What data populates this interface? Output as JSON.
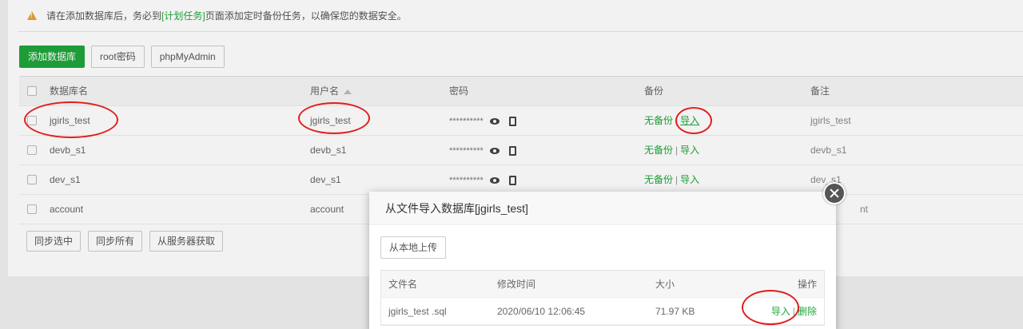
{
  "alert": {
    "text_before": "请在添加数据库后，务必到",
    "link": "[计划任务]",
    "text_after": "页面添加定时备份任务，以确保您的数据安全。"
  },
  "toolbar": {
    "add_label": "添加数据库",
    "root_label": "root密码",
    "pma_label": "phpMyAdmin"
  },
  "table": {
    "headers": {
      "name": "数据库名",
      "user": "用户名",
      "password": "密码",
      "backup": "备份",
      "remark": "备注"
    },
    "rows": [
      {
        "name": "jgirls_test",
        "user": "jgirls_test",
        "password": "**********",
        "backup": "无备份",
        "import": "导入",
        "remark": "jgirls_test"
      },
      {
        "name": "devb_s1",
        "user": "devb_s1",
        "password": "**********",
        "backup": "无备份",
        "import": "导入",
        "remark": "devb_s1"
      },
      {
        "name": "dev_s1",
        "user": "dev_s1",
        "password": "**********",
        "backup": "无备份",
        "import": "导入",
        "remark": "dev_s1"
      },
      {
        "name": "account",
        "user": "account",
        "password": "",
        "backup": "",
        "import": "",
        "remark": "nt"
      }
    ],
    "separator": "|"
  },
  "footer": {
    "sync_selected": "同步选中",
    "sync_all": "同步所有",
    "fetch_server": "从服务器获取"
  },
  "modal": {
    "title": "从文件导入数据库[jgirls_test]",
    "upload_label": "从本地上传",
    "headers": {
      "filename": "文件名",
      "modified": "修改时间",
      "size": "大小",
      "actions": "操作"
    },
    "files": [
      {
        "filename": "jgirls_test .sql",
        "modified": "2020/06/10 12:06:45",
        "size": "71.97 KB",
        "import": "导入",
        "delete": "删除"
      }
    ]
  },
  "colors": {
    "accent": "#20a53a",
    "annotation": "#e01e1e",
    "warning": "#e6a23c"
  }
}
